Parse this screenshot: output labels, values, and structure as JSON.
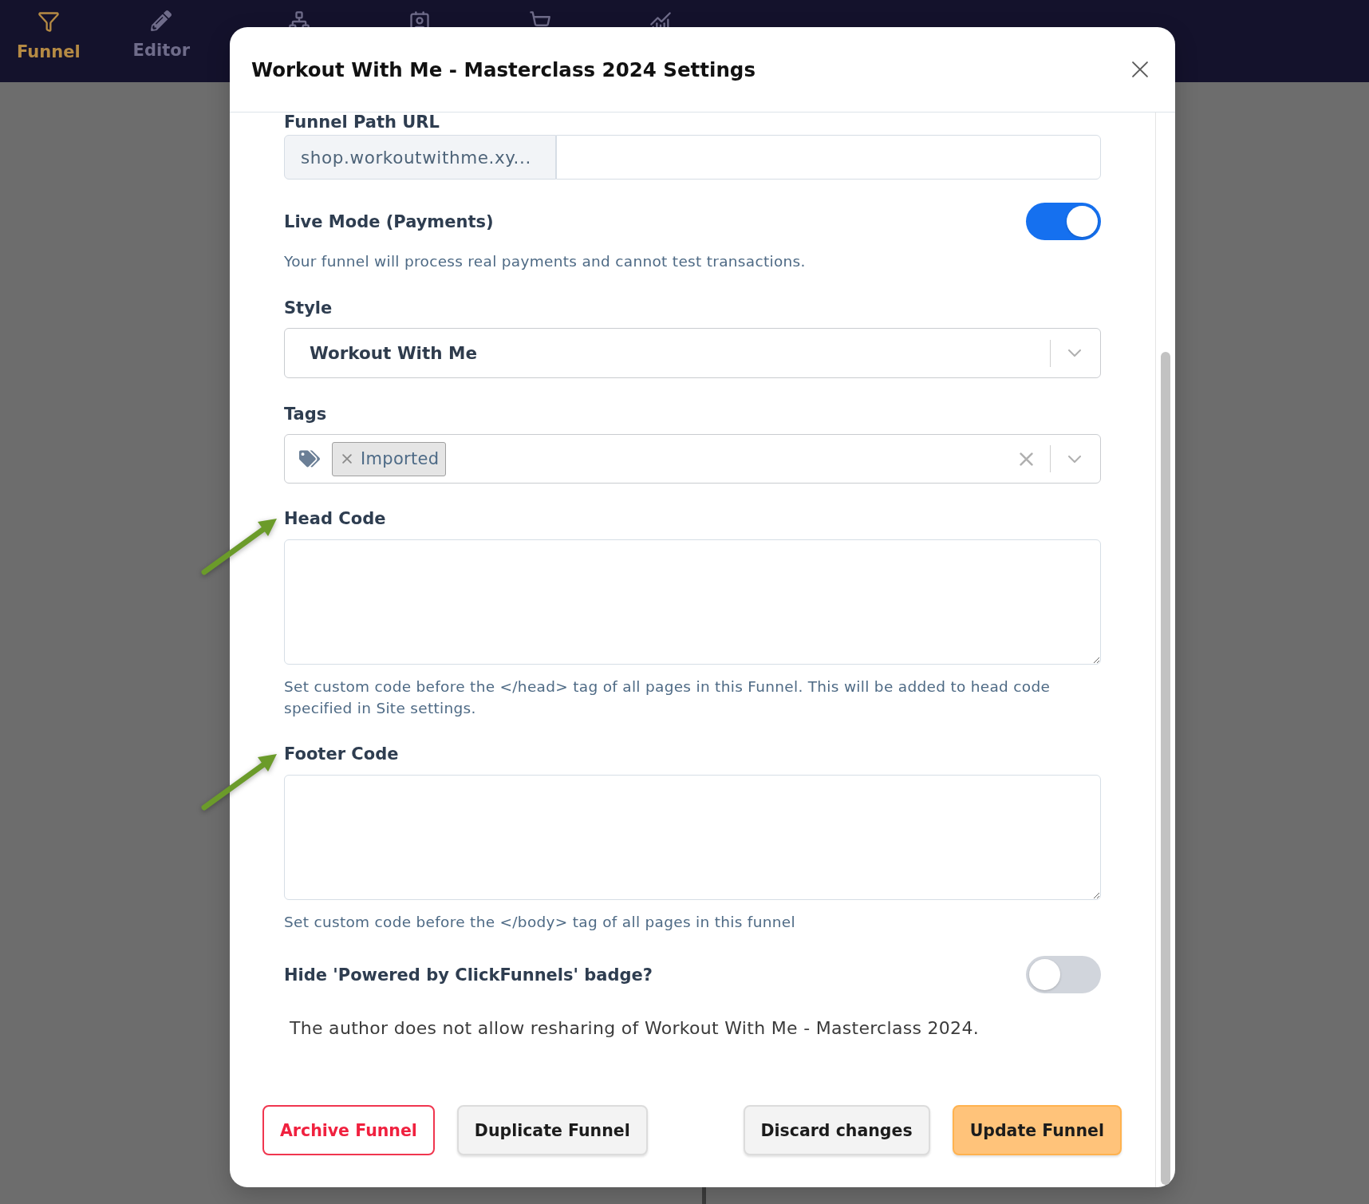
{
  "nav": {
    "items": [
      {
        "label": "Funnel",
        "selected": true
      },
      {
        "label": "Editor",
        "selected": false
      },
      {
        "selected": false
      },
      {
        "selected": false
      },
      {
        "selected": false
      },
      {
        "selected": false
      }
    ]
  },
  "dialog": {
    "title": "Workout With Me - Masterclass 2024 Settings",
    "fields": [
      {
        "kind": "url",
        "label": "Funnel Path URL",
        "prefix": "shop.workoutwithme.xy..."
      },
      {
        "kind": "toggle",
        "label": "Live Mode (Payments)",
        "on": true,
        "help": "Your funnel will process real payments and cannot test transactions."
      },
      {
        "kind": "select",
        "label": "Style",
        "value": "Workout With Me"
      },
      {
        "kind": "tags",
        "label": "Tags",
        "tags": [
          {
            "label": "Imported"
          }
        ]
      },
      {
        "kind": "textarea",
        "label": "Head Code",
        "annotated": true,
        "help": "Set custom code before the </head> tag of all pages in this Funnel. This will be added to head code specified in Site settings."
      },
      {
        "kind": "textarea",
        "label": "Footer Code",
        "annotated": true,
        "help": "Set custom code before the </body> tag of all pages in this funnel"
      },
      {
        "kind": "toggle",
        "label": "Hide 'Powered by ClickFunnels' badge?",
        "on": false
      },
      {
        "kind": "note",
        "text": "The author does not allow resharing of Workout With Me - Masterclass 2024."
      }
    ],
    "footer": {
      "start_buttons": [
        {
          "label": "Archive Funnel",
          "kind": "danger"
        },
        {
          "label": "Duplicate Funnel",
          "kind": "secondary"
        }
      ],
      "end_buttons": [
        {
          "label": "Discard changes",
          "kind": "secondary"
        },
        {
          "label": "Update Funnel",
          "kind": "primary"
        }
      ]
    }
  }
}
